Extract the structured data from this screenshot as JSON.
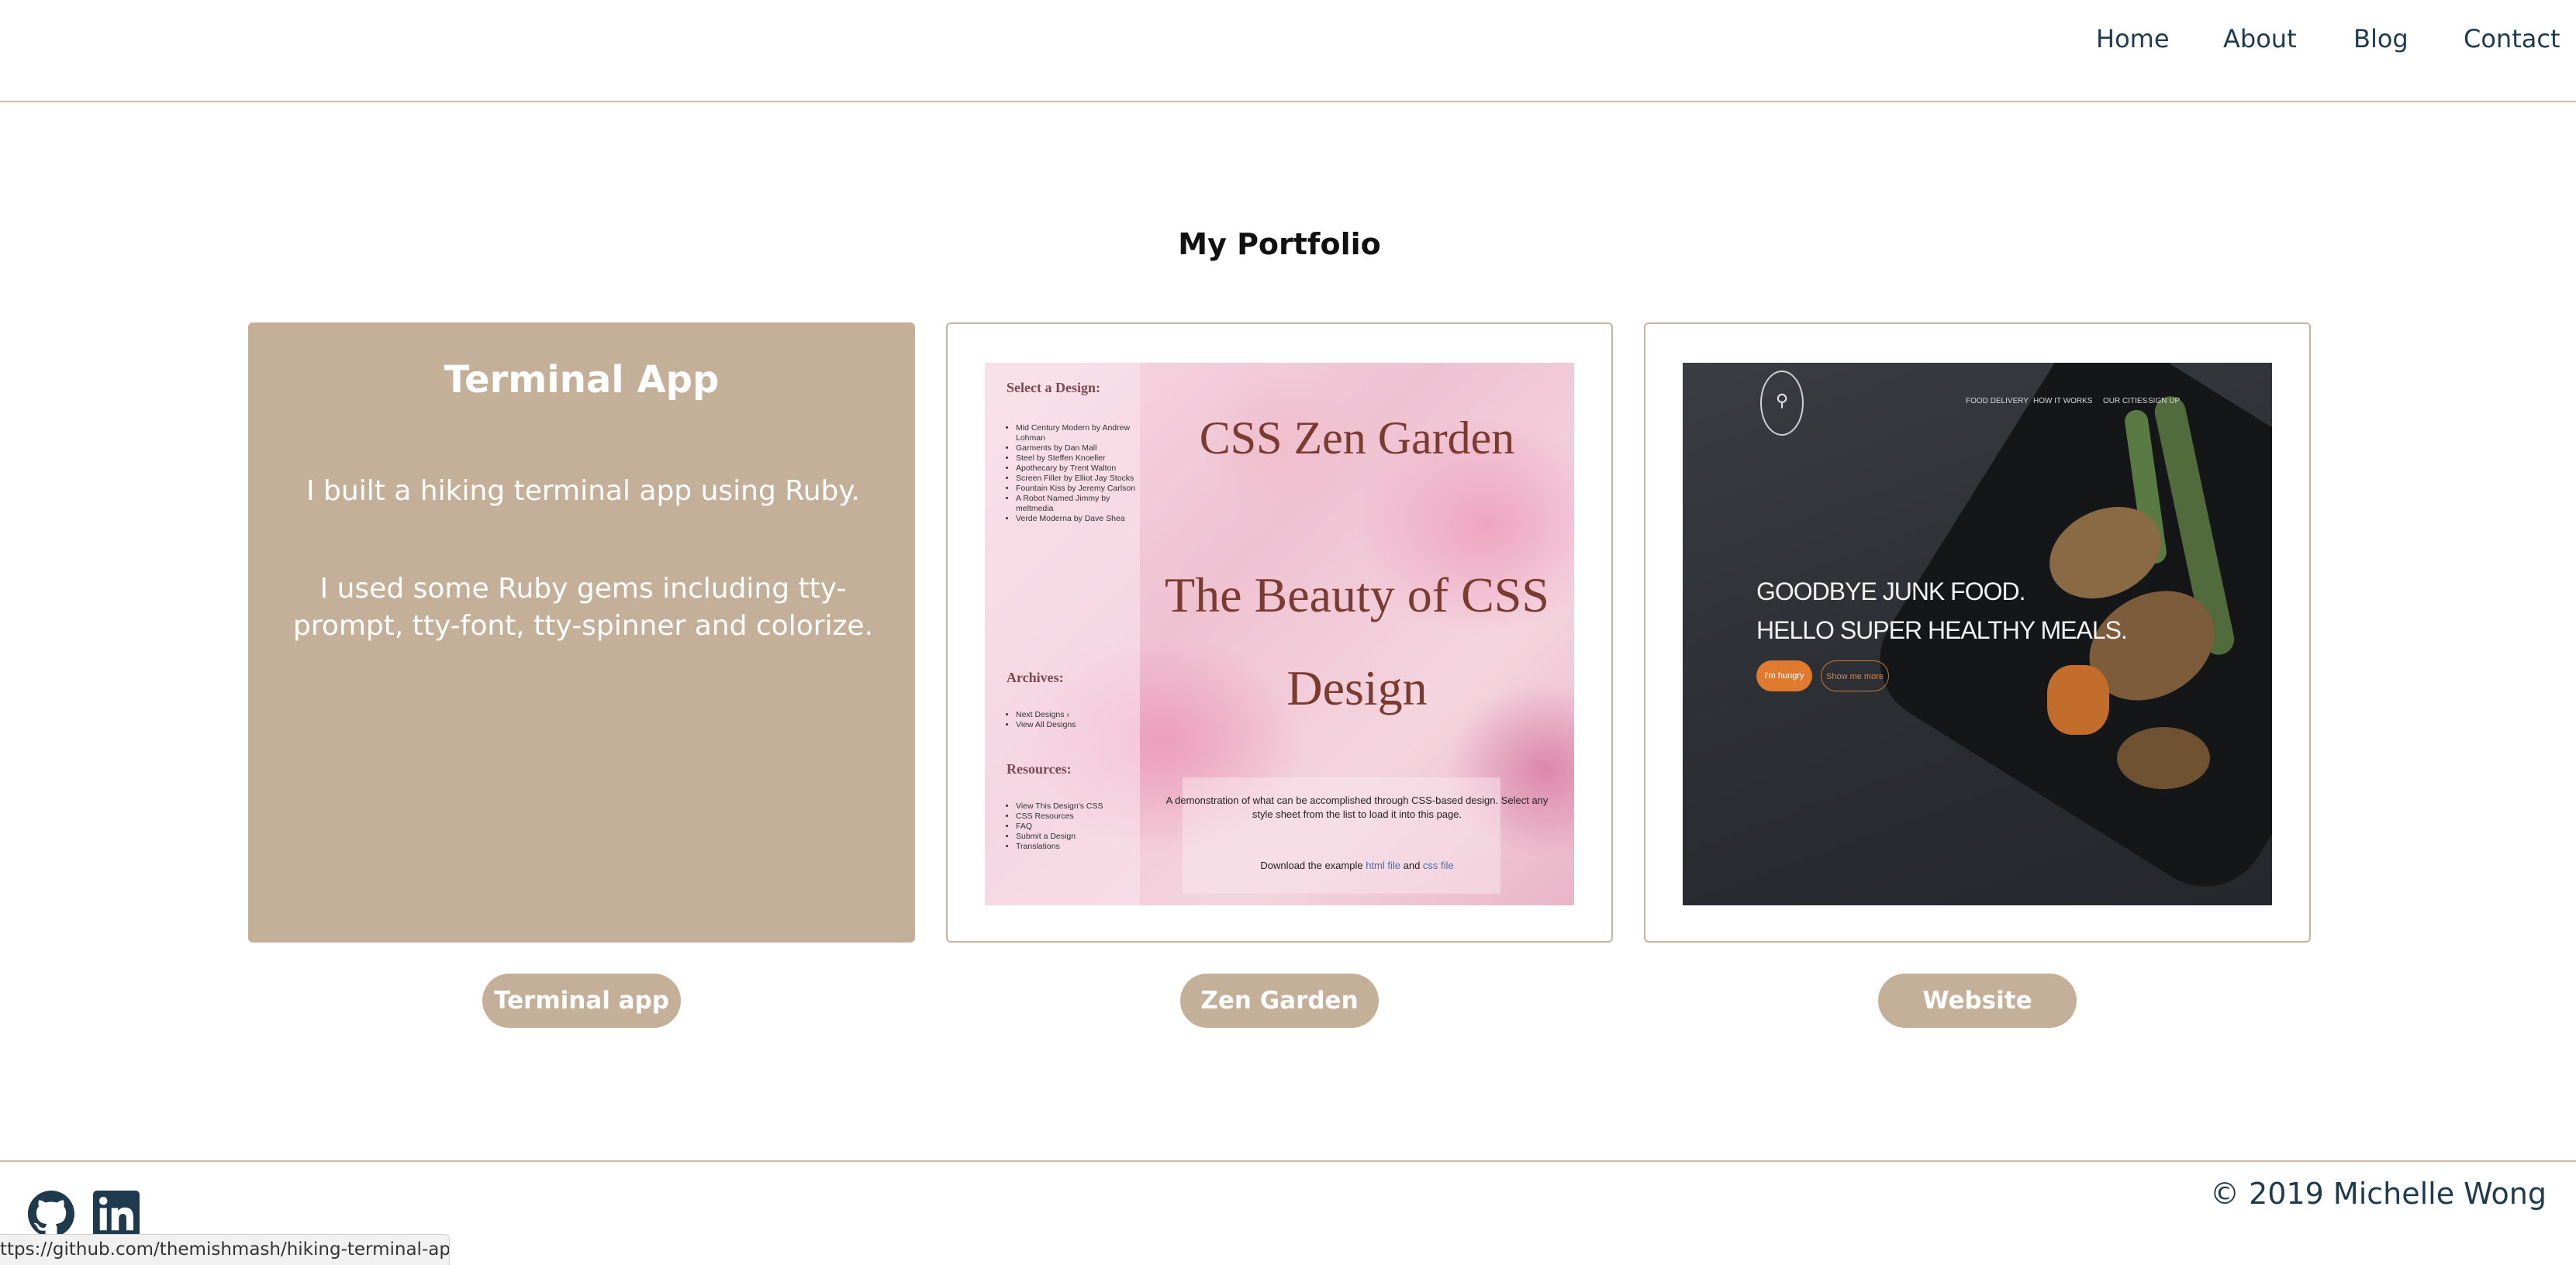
{
  "nav": {
    "home": "Home",
    "about": "About",
    "blog": "Blog",
    "contact": "Contact"
  },
  "page": {
    "title": "My Portfolio"
  },
  "cards": [
    {
      "heading": "Terminal App",
      "paragraph_1": "I built a hiking terminal app using Ruby.",
      "paragraph_2": "I used some Ruby gems including tty-prompt, tty-font, tty-spinner and colorize.",
      "button": "Terminal app"
    },
    {
      "preview": {
        "sidebar_heading_1": "Select a Design:",
        "sidebar_items_1": [
          "Mid Century Modern by Andrew Lohman",
          "Garments by Dan Mall",
          "Steel by Steffen Knoeller",
          "Apothecary by Trent Walton",
          "Screen Filler by Elliot Jay Stocks",
          "Fountain Kiss by Jeremy Carlson",
          "A Robot Named Jimmy by meltmedia",
          "Verde Moderna by Dave Shea"
        ],
        "sidebar_heading_2": "Archives:",
        "sidebar_items_2": [
          "Next Designs ›",
          "View All Designs"
        ],
        "sidebar_heading_3": "Resources:",
        "sidebar_items_3": [
          "View This Design's CSS",
          "CSS Resources",
          "FAQ",
          "Submit a Design",
          "Translations"
        ],
        "title": "CSS Zen Garden",
        "subtitle": "The Beauty of CSS Design",
        "caption": "A demonstration of what can be accomplished through CSS-based design. Select any style sheet from the list to load it into this page.",
        "download_prefix": "Download the example ",
        "download_html": "html file",
        "download_and": " and ",
        "download_css": "css file"
      },
      "button": "Zen Garden"
    },
    {
      "preview": {
        "nav_1": "FOOD DELIVERY",
        "nav_2": "HOW IT WORKS",
        "nav_3": "OUR CITIES",
        "nav_4": "SIGN UP",
        "headline_1": "GOODBYE JUNK FOOD.",
        "headline_2": "HELLO SUPER HEALTHY MEALS.",
        "cta_primary": "I'm hungry",
        "cta_secondary": "Show me more"
      },
      "button": "Website"
    }
  ],
  "footer": {
    "copyright": "© 2019 Michelle Wong",
    "icons": [
      "github-icon",
      "linkedin-icon"
    ]
  },
  "statusbar": {
    "url": "ttps://github.com/themishmash/hiking-terminal-app"
  },
  "colors": {
    "accent": "#c4af98",
    "nav_text": "#1f3a4d",
    "divider": "#d8b6a4"
  }
}
